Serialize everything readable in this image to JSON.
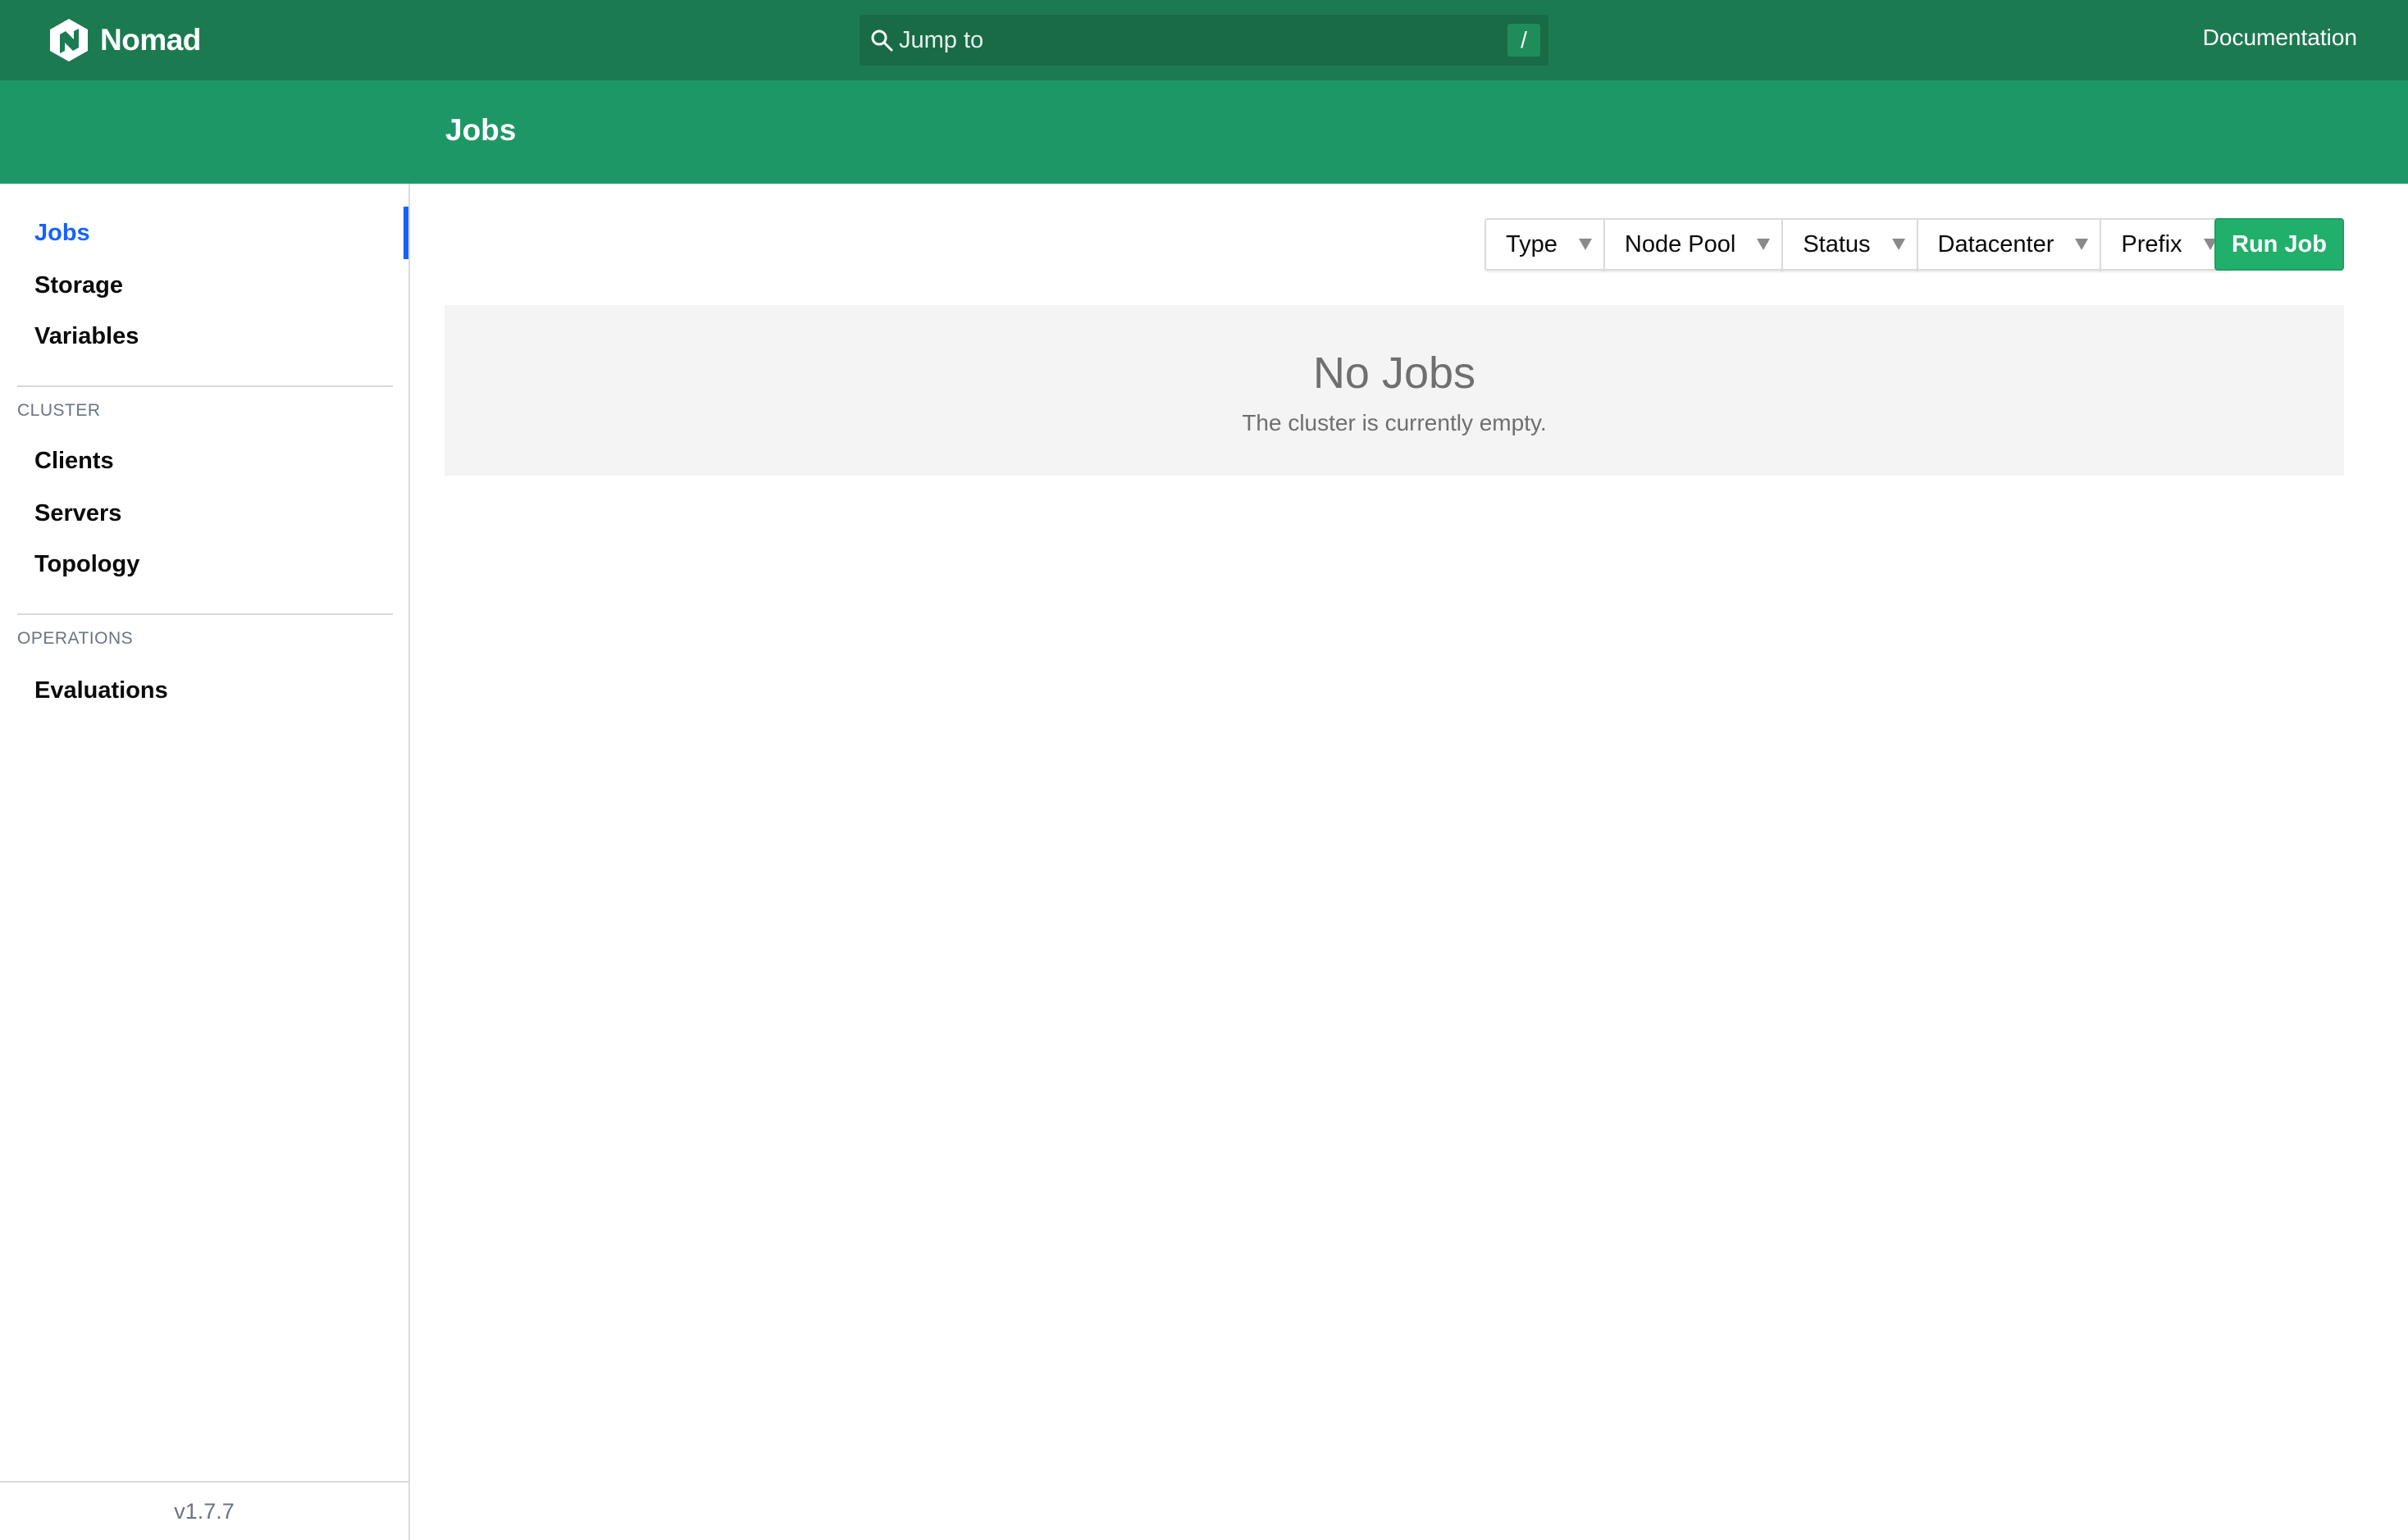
{
  "brand": {
    "name": "Nomad"
  },
  "search": {
    "placeholder": "Jump to",
    "shortcut": "/"
  },
  "header": {
    "doc_link": "Documentation",
    "page_title": "Jobs"
  },
  "sidebar": {
    "items_top": [
      {
        "label": "Jobs",
        "active": true
      },
      {
        "label": "Storage"
      },
      {
        "label": "Variables"
      }
    ],
    "cluster_label": "CLUSTER",
    "cluster_items": [
      {
        "label": "Clients"
      },
      {
        "label": "Servers"
      },
      {
        "label": "Topology"
      }
    ],
    "operations_label": "OPERATIONS",
    "operations_items": [
      {
        "label": "Evaluations"
      }
    ],
    "version": "v1.7.7"
  },
  "filters": {
    "type": "Type",
    "node_pool": "Node Pool",
    "status": "Status",
    "datacenter": "Datacenter",
    "prefix": "Prefix"
  },
  "actions": {
    "run_job": "Run Job"
  },
  "empty_state": {
    "title": "No Jobs",
    "message": "The cluster is currently empty."
  },
  "colors": {
    "nav_bg": "#1c7a50",
    "subheader_bg": "#1e9766",
    "accent_blue": "#1563ff",
    "run_button": "#21b06b"
  }
}
